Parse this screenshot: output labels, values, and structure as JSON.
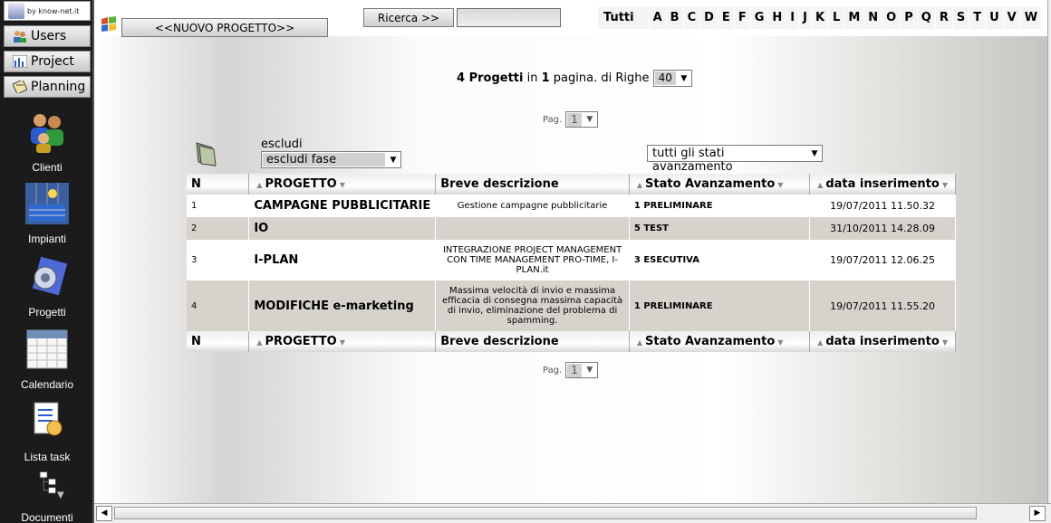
{
  "brand": {
    "text": "by know-net.it"
  },
  "sidebar": {
    "nav": [
      {
        "label": "Users",
        "icon": "users-icon"
      },
      {
        "label": "Project",
        "icon": "chart-icon"
      },
      {
        "label": "Planning",
        "icon": "planning-icon"
      }
    ],
    "tools": [
      {
        "label": "Clienti",
        "icon": "clients-icon"
      },
      {
        "label": "Impianti",
        "icon": "plants-icon"
      },
      {
        "label": "Progetti",
        "icon": "projects-icon"
      },
      {
        "label": "Calendario",
        "icon": "calendar-icon"
      },
      {
        "label": "Lista task",
        "icon": "task-list-icon"
      },
      {
        "label": "Documenti",
        "icon": "documents-icon"
      }
    ]
  },
  "toolbar": {
    "new_project": "<<NUOVO PROGETTO>>",
    "search_button": "Ricerca >>",
    "search_value": "",
    "alphabet_all": "Tutti",
    "letters": [
      "A",
      "B",
      "C",
      "D",
      "E",
      "F",
      "G",
      "H",
      "I",
      "J",
      "K",
      "L",
      "M",
      "N",
      "O",
      "P",
      "Q",
      "R",
      "S",
      "T",
      "U",
      "V",
      "W"
    ]
  },
  "summary": {
    "count": "4 Progetti",
    "in": "in",
    "pages": "1",
    "pages_label": "pagina. di Righe",
    "rows": "40"
  },
  "pagination": {
    "label": "Pag.",
    "page": "1"
  },
  "filters": {
    "exclude_label": "escludi",
    "exclude_value": "escludi fase",
    "status_value": "tutti gli stati avanzamento"
  },
  "table": {
    "columns": {
      "n": "N",
      "project": "PROGETTO",
      "description": "Breve descrizione",
      "status": "Stato Avanzamento",
      "date": "data inserimento"
    },
    "rows": [
      {
        "n": "1",
        "project": "CAMPAGNE PUBBLICITARIE",
        "description": "Gestione campagne pubblicitarie",
        "status": "1 PRELIMINARE",
        "date": "19/07/2011 11.50.32"
      },
      {
        "n": "2",
        "project": "IO",
        "description": "",
        "status": "5 TEST",
        "date": "31/10/2011 14.28.09"
      },
      {
        "n": "3",
        "project": "I-PLAN",
        "description": "INTEGRAZIONE PROJECT MANAGEMENT CON TIME MANAGEMENT PRO-TIME, I-PLAN.it",
        "status": "3 ESECUTIVA",
        "date": "19/07/2011 12.06.25"
      },
      {
        "n": "4",
        "project": "MODIFICHE e-marketing",
        "description": "Massima velocità di invio e massima efficacia di consegna massima capacità di invio, eliminazione del problema di spamming.",
        "status": "1 PRELIMINARE",
        "date": "19/07/2011 11.55.20"
      }
    ]
  },
  "colors": {
    "sidebar_bg": "#1b1b1b",
    "row_alt": "#d6d3cc",
    "header_bg": "#eeeeee"
  }
}
